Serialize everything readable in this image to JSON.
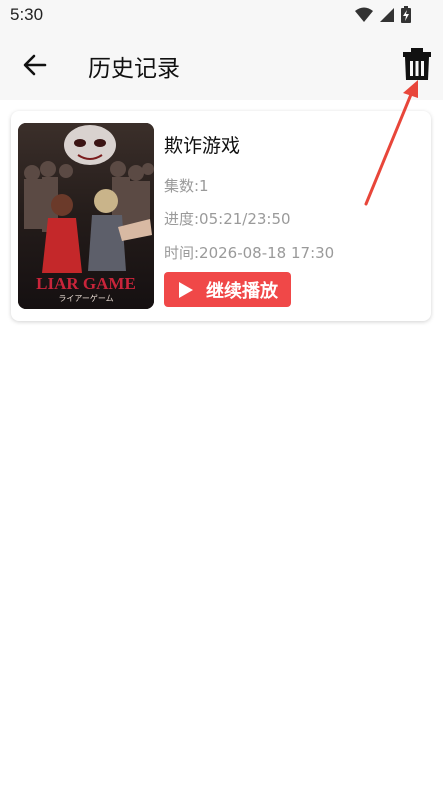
{
  "status_bar": {
    "time": "5:30",
    "icons": [
      "wifi-icon",
      "cellular-signal-icon",
      "battery-charging-icon"
    ]
  },
  "app_bar": {
    "title": "历史记录",
    "back_icon": "arrow-left-icon",
    "delete_icon": "trash-icon"
  },
  "history": {
    "items": [
      {
        "title": "欺诈游戏",
        "episode": "集数:1",
        "progress": "进度:05:21/23:50",
        "time": "时间:2026-08-18 17:30",
        "resume_label": "继续播放",
        "poster_logo": "LIAR GAME",
        "poster_sub": "ライアーゲーム"
      }
    ]
  },
  "colors": {
    "accent": "#f04848",
    "annotation_arrow": "#e8463a",
    "meta_text": "#9a9a9a",
    "bar_background": "#f7f7f7"
  }
}
